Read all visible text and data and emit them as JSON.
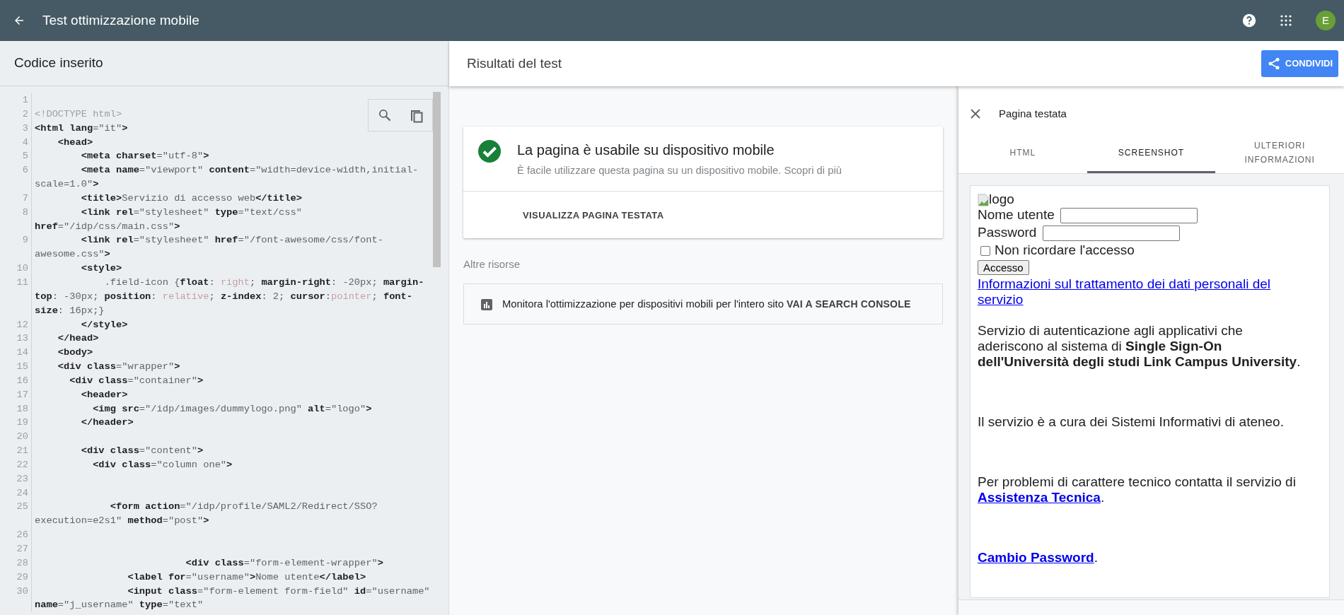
{
  "app_bar": {
    "title": "Test ottimizzazione mobile",
    "avatar_initial": "E"
  },
  "code_panel": {
    "title": "Codice inserito",
    "lines": [
      {
        "number": "1"
      },
      {
        "number": "2",
        "segments": [
          {
            "kind": "muted",
            "text": "<!DOCTYPE html>"
          }
        ]
      },
      {
        "number": "3",
        "segments": [
          {
            "kind": "markup",
            "text": "<html lang"
          },
          {
            "kind": "value",
            "text": "=\"it\""
          },
          {
            "kind": "markup",
            "text": ">"
          }
        ]
      },
      {
        "number": "4",
        "segments": [
          {
            "kind": "markup",
            "text": "    <head>"
          }
        ]
      },
      {
        "number": "5",
        "segments": [
          {
            "kind": "markup",
            "text": "        <meta charset"
          },
          {
            "kind": "value",
            "text": "=\"utf-8\""
          },
          {
            "kind": "markup",
            "text": ">"
          }
        ]
      },
      {
        "number": "6",
        "segments": [
          {
            "kind": "markup",
            "text": "        <meta name"
          },
          {
            "kind": "value",
            "text": "=\"viewport\" "
          },
          {
            "kind": "markup",
            "text": "content"
          },
          {
            "kind": "value",
            "text": "=\"width=device-width,initial-scale=1.0\""
          },
          {
            "kind": "markup",
            "text": ">"
          }
        ]
      },
      {
        "number": "7",
        "segments": [
          {
            "kind": "markup",
            "text": "        <title>"
          },
          {
            "kind": "value",
            "text": "Servizio di accesso web"
          },
          {
            "kind": "markup",
            "text": "</title>"
          }
        ]
      },
      {
        "number": "8",
        "segments": [
          {
            "kind": "markup",
            "text": "        <link rel"
          },
          {
            "kind": "value",
            "text": "=\"stylesheet\" "
          },
          {
            "kind": "markup",
            "text": "type"
          },
          {
            "kind": "value",
            "text": "=\"text/css\" "
          },
          {
            "kind": "markup",
            "text": "href"
          },
          {
            "kind": "value",
            "text": "=\"/idp/css/main.css\""
          },
          {
            "kind": "markup",
            "text": ">"
          }
        ]
      },
      {
        "number": "9",
        "segments": [
          {
            "kind": "markup",
            "text": "        <link rel"
          },
          {
            "kind": "value",
            "text": "=\"stylesheet\" "
          },
          {
            "kind": "markup",
            "text": "href"
          },
          {
            "kind": "value",
            "text": "=\"/font-awesome/css/font-awesome.css\""
          },
          {
            "kind": "markup",
            "text": ">"
          }
        ]
      },
      {
        "number": "10",
        "segments": [
          {
            "kind": "markup",
            "text": "        <style>"
          }
        ]
      },
      {
        "number": "11",
        "segments": [
          {
            "kind": "value",
            "text": "            .field-icon {"
          },
          {
            "kind": "markup",
            "text": "float"
          },
          {
            "kind": "value",
            "text": ": "
          },
          {
            "kind": "keyword",
            "text": "right"
          },
          {
            "kind": "value",
            "text": "; "
          },
          {
            "kind": "markup",
            "text": "margin-right"
          },
          {
            "kind": "value",
            "text": ": -20px; "
          },
          {
            "kind": "markup",
            "text": "margin-top"
          },
          {
            "kind": "value",
            "text": ": -30px; "
          },
          {
            "kind": "markup",
            "text": "position"
          },
          {
            "kind": "value",
            "text": ": "
          },
          {
            "kind": "keyword",
            "text": "relative"
          },
          {
            "kind": "value",
            "text": "; "
          },
          {
            "kind": "markup",
            "text": "z-index"
          },
          {
            "kind": "value",
            "text": ": 2; "
          },
          {
            "kind": "markup",
            "text": "cursor"
          },
          {
            "kind": "value",
            "text": ":"
          },
          {
            "kind": "keyword",
            "text": "pointer"
          },
          {
            "kind": "value",
            "text": "; "
          },
          {
            "kind": "markup",
            "text": "font-size"
          },
          {
            "kind": "value",
            "text": ": 16px;}"
          }
        ]
      },
      {
        "number": "12",
        "segments": [
          {
            "kind": "markup",
            "text": "        </style>"
          }
        ]
      },
      {
        "number": "13",
        "segments": [
          {
            "kind": "markup",
            "text": "    </head>"
          }
        ]
      },
      {
        "number": "14",
        "segments": [
          {
            "kind": "markup",
            "text": "    <body>"
          }
        ]
      },
      {
        "number": "15",
        "segments": [
          {
            "kind": "markup",
            "text": "    <div class"
          },
          {
            "kind": "value",
            "text": "=\"wrapper\""
          },
          {
            "kind": "markup",
            "text": ">"
          }
        ]
      },
      {
        "number": "16",
        "segments": [
          {
            "kind": "markup",
            "text": "      <div class"
          },
          {
            "kind": "value",
            "text": "=\"container\""
          },
          {
            "kind": "markup",
            "text": ">"
          }
        ]
      },
      {
        "number": "17",
        "segments": [
          {
            "kind": "markup",
            "text": "        <header>"
          }
        ]
      },
      {
        "number": "18",
        "segments": [
          {
            "kind": "markup",
            "text": "          <img src"
          },
          {
            "kind": "value",
            "text": "=\"/idp/images/dummylogo.png\" "
          },
          {
            "kind": "markup",
            "text": "alt"
          },
          {
            "kind": "value",
            "text": "=\"logo\""
          },
          {
            "kind": "markup",
            "text": ">"
          }
        ]
      },
      {
        "number": "19",
        "segments": [
          {
            "kind": "markup",
            "text": "        </header>"
          }
        ]
      },
      {
        "number": "20"
      },
      {
        "number": "21",
        "segments": [
          {
            "kind": "markup",
            "text": "        <div class"
          },
          {
            "kind": "value",
            "text": "=\"content\""
          },
          {
            "kind": "markup",
            "text": ">"
          }
        ]
      },
      {
        "number": "22",
        "segments": [
          {
            "kind": "markup",
            "text": "          <div class"
          },
          {
            "kind": "value",
            "text": "=\"column one\""
          },
          {
            "kind": "markup",
            "text": ">"
          }
        ]
      },
      {
        "number": "23"
      },
      {
        "number": "24"
      },
      {
        "number": "25",
        "segments": [
          {
            "kind": "markup",
            "text": "             <form action"
          },
          {
            "kind": "value",
            "text": "=\"/idp/profile/SAML2/Redirect/SSO?"
          },
          {
            "kind": "value",
            "text": "execution=e2s1\" "
          },
          {
            "kind": "markup",
            "text": "method"
          },
          {
            "kind": "value",
            "text": "=\"post\""
          },
          {
            "kind": "markup",
            "text": ">"
          }
        ]
      },
      {
        "number": "26"
      },
      {
        "number": "27"
      },
      {
        "number": "28",
        "segments": [
          {
            "kind": "markup",
            "text": "                          <div class"
          },
          {
            "kind": "value",
            "text": "=\"form-element-wrapper\""
          },
          {
            "kind": "markup",
            "text": ">"
          }
        ]
      },
      {
        "number": "29",
        "segments": [
          {
            "kind": "markup",
            "text": "                <label for"
          },
          {
            "kind": "value",
            "text": "=\"username\""
          },
          {
            "kind": "markup",
            "text": ">"
          },
          {
            "kind": "value",
            "text": "Nome utente"
          },
          {
            "kind": "markup",
            "text": "</label>"
          }
        ]
      },
      {
        "number": "30",
        "segments": [
          {
            "kind": "markup",
            "text": "                <input class"
          },
          {
            "kind": "value",
            "text": "=\"form-element form-field\" "
          },
          {
            "kind": "markup",
            "text": "id"
          },
          {
            "kind": "value",
            "text": "=\"username\" "
          },
          {
            "kind": "markup",
            "text": "name"
          },
          {
            "kind": "value",
            "text": "=\"j_username\" "
          },
          {
            "kind": "markup",
            "text": "type"
          },
          {
            "kind": "value",
            "text": "=\"text\""
          }
        ]
      }
    ]
  },
  "results": {
    "title": "Risultati del test",
    "share_button": "CONDIVIDI",
    "verdict": {
      "usable": true,
      "title": "La pagina è usabile su dispositivo mobile",
      "description": "È facile utilizzare questa pagina su un dispositivo mobile.",
      "link": "Scopri di più",
      "action": "VISUALIZZA PAGINA TESTATA"
    },
    "other_resources": {
      "heading": "Altre risorse",
      "text": "Monitora l'ottimizzazione per dispositivi mobili per l'intero sito",
      "link": "VAI A SEARCH CONSOLE"
    }
  },
  "tested_page": {
    "title": "Pagina testata",
    "tabs": [
      {
        "label": "HTML",
        "selected": false
      },
      {
        "label": "SCREENSHOT",
        "selected": true
      },
      {
        "label": "ULTERIORI INFORMAZIONI",
        "selected": false
      }
    ],
    "screenshot": {
      "logo_alt": "logo",
      "fields": [
        {
          "label": "Nome utente"
        },
        {
          "label": "Password"
        }
      ],
      "checkbox": {
        "label": "Non ricordare l'accesso",
        "checked": false
      },
      "button": "Accesso",
      "privacy_link": "Informazioni sul trattamento dei dati personali del servizio",
      "paragraphs": [
        {
          "text": "Servizio di autenticazione agli applicativi che aderiscono al sistema di **Single Sign-On dell'Università degli studi Link Campus University**."
        },
        {
          "text": "Il servizio è a cura dei Sistemi Informativi di ateneo."
        },
        {
          "text": "Per problemi di carattere tecnico contatta il servizio di",
          "link": "Assistenza Tecnica",
          "suffix": "."
        },
        {
          "link": "Cambio Password",
          "suffix": "."
        }
      ]
    }
  }
}
